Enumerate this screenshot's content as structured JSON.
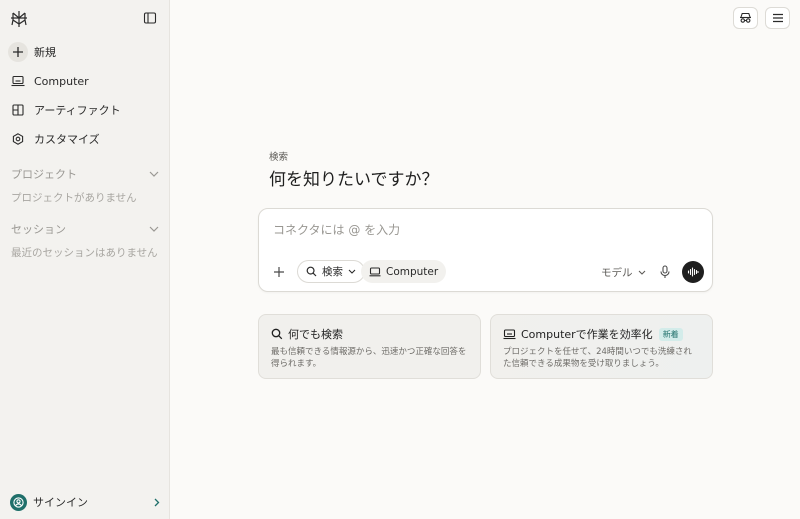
{
  "sidebar": {
    "nav": [
      {
        "label": "新規",
        "icon": "plus-icon"
      },
      {
        "label": "Computer",
        "icon": "laptop-icon"
      },
      {
        "label": "アーティファクト",
        "icon": "artifact-icon"
      },
      {
        "label": "カスタマイズ",
        "icon": "hexagon-settings-icon"
      }
    ],
    "projects": {
      "title": "プロジェクト",
      "empty": "プロジェクトがありません"
    },
    "sessions": {
      "title": "セッション",
      "empty": "最近のセッションはありません"
    },
    "signin_label": "サインイン"
  },
  "main": {
    "eyebrow": "検索",
    "headline": "何を知りたいですか？"
  },
  "composer": {
    "placeholder": "コネクタには @ を入力",
    "search_chip": "検索",
    "computer_chip": "Computer",
    "model_label": "モデル"
  },
  "cards": [
    {
      "title": "何でも検索",
      "desc": "最も信頼できる情報源から、迅速かつ正確な回答を得られます。",
      "badge": ""
    },
    {
      "title": "Computerで作業を効率化",
      "desc": "プロジェクトを任せて、24時間いつでも洗練された信頼できる成果物を受け取りましょう。",
      "badge": "新着"
    }
  ],
  "colors": {
    "accent": "#1f6f6a",
    "sidebar_bg": "#f3f2ef",
    "page_bg": "#fbfaf8"
  }
}
